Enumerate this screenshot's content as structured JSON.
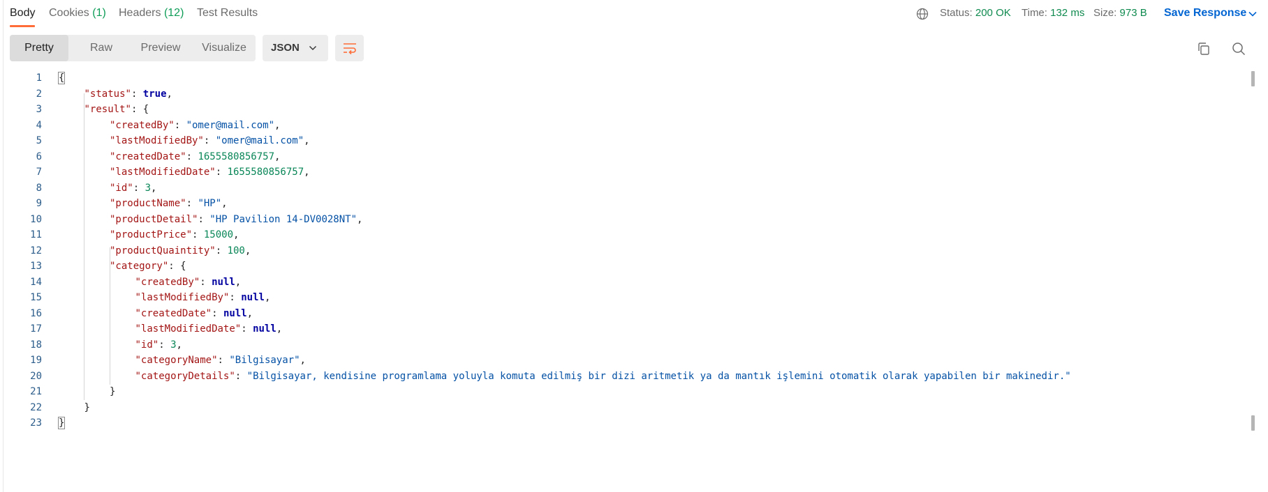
{
  "tabs": [
    {
      "label": "Body",
      "count": ""
    },
    {
      "label": "Cookies",
      "count": "(1)"
    },
    {
      "label": "Headers",
      "count": "(12)"
    },
    {
      "label": "Test Results",
      "count": ""
    }
  ],
  "status": {
    "status_label": "Status:",
    "status_value": "200 OK",
    "time_label": "Time:",
    "time_value": "132 ms",
    "size_label": "Size:",
    "size_value": "973 B"
  },
  "save_response_label": "Save Response",
  "view_tabs": [
    "Pretty",
    "Raw",
    "Preview",
    "Visualize"
  ],
  "format_select": "JSON",
  "colors": {
    "accent": "#ff6c37",
    "link": "#0265d2",
    "success": "#0f8a4f",
    "json_key": "#a31515",
    "json_string": "#0451a5",
    "json_number": "#098658",
    "json_literal": "#0000a0"
  },
  "icons": [
    "globe-icon",
    "chevron-down-icon",
    "wrap-lines-icon",
    "copy-icon",
    "search-icon"
  ],
  "code_lines": [
    {
      "n": "1",
      "indent": 0,
      "tokens": [
        {
          "t": "p",
          "v": "{"
        }
      ]
    },
    {
      "n": "2",
      "indent": 1,
      "tokens": [
        {
          "t": "k",
          "v": "\"status\""
        },
        {
          "t": "p",
          "v": ": "
        },
        {
          "t": "b",
          "v": "true"
        },
        {
          "t": "p",
          "v": ","
        }
      ]
    },
    {
      "n": "3",
      "indent": 1,
      "tokens": [
        {
          "t": "k",
          "v": "\"result\""
        },
        {
          "t": "p",
          "v": ": {"
        }
      ]
    },
    {
      "n": "4",
      "indent": 2,
      "tokens": [
        {
          "t": "k",
          "v": "\"createdBy\""
        },
        {
          "t": "p",
          "v": ": "
        },
        {
          "t": "s",
          "v": "\"omer@mail.com\""
        },
        {
          "t": "p",
          "v": ","
        }
      ]
    },
    {
      "n": "5",
      "indent": 2,
      "tokens": [
        {
          "t": "k",
          "v": "\"lastModifiedBy\""
        },
        {
          "t": "p",
          "v": ": "
        },
        {
          "t": "s",
          "v": "\"omer@mail.com\""
        },
        {
          "t": "p",
          "v": ","
        }
      ]
    },
    {
      "n": "6",
      "indent": 2,
      "tokens": [
        {
          "t": "k",
          "v": "\"createdDate\""
        },
        {
          "t": "p",
          "v": ": "
        },
        {
          "t": "n",
          "v": "1655580856757"
        },
        {
          "t": "p",
          "v": ","
        }
      ]
    },
    {
      "n": "7",
      "indent": 2,
      "tokens": [
        {
          "t": "k",
          "v": "\"lastModifiedDate\""
        },
        {
          "t": "p",
          "v": ": "
        },
        {
          "t": "n",
          "v": "1655580856757"
        },
        {
          "t": "p",
          "v": ","
        }
      ]
    },
    {
      "n": "8",
      "indent": 2,
      "tokens": [
        {
          "t": "k",
          "v": "\"id\""
        },
        {
          "t": "p",
          "v": ": "
        },
        {
          "t": "n",
          "v": "3"
        },
        {
          "t": "p",
          "v": ","
        }
      ]
    },
    {
      "n": "9",
      "indent": 2,
      "tokens": [
        {
          "t": "k",
          "v": "\"productName\""
        },
        {
          "t": "p",
          "v": ": "
        },
        {
          "t": "s",
          "v": "\"HP\""
        },
        {
          "t": "p",
          "v": ","
        }
      ]
    },
    {
      "n": "10",
      "indent": 2,
      "tokens": [
        {
          "t": "k",
          "v": "\"productDetail\""
        },
        {
          "t": "p",
          "v": ": "
        },
        {
          "t": "s",
          "v": "\"HP Pavilion 14-DV0028NT\""
        },
        {
          "t": "p",
          "v": ","
        }
      ]
    },
    {
      "n": "11",
      "indent": 2,
      "tokens": [
        {
          "t": "k",
          "v": "\"productPrice\""
        },
        {
          "t": "p",
          "v": ": "
        },
        {
          "t": "n",
          "v": "15000"
        },
        {
          "t": "p",
          "v": ","
        }
      ]
    },
    {
      "n": "12",
      "indent": 2,
      "tokens": [
        {
          "t": "k",
          "v": "\"productQuaintity\""
        },
        {
          "t": "p",
          "v": ": "
        },
        {
          "t": "n",
          "v": "100"
        },
        {
          "t": "p",
          "v": ","
        }
      ]
    },
    {
      "n": "13",
      "indent": 2,
      "tokens": [
        {
          "t": "k",
          "v": "\"category\""
        },
        {
          "t": "p",
          "v": ": {"
        }
      ]
    },
    {
      "n": "14",
      "indent": 3,
      "tokens": [
        {
          "t": "k",
          "v": "\"createdBy\""
        },
        {
          "t": "p",
          "v": ": "
        },
        {
          "t": "b",
          "v": "null"
        },
        {
          "t": "p",
          "v": ","
        }
      ]
    },
    {
      "n": "15",
      "indent": 3,
      "tokens": [
        {
          "t": "k",
          "v": "\"lastModifiedBy\""
        },
        {
          "t": "p",
          "v": ": "
        },
        {
          "t": "b",
          "v": "null"
        },
        {
          "t": "p",
          "v": ","
        }
      ]
    },
    {
      "n": "16",
      "indent": 3,
      "tokens": [
        {
          "t": "k",
          "v": "\"createdDate\""
        },
        {
          "t": "p",
          "v": ": "
        },
        {
          "t": "b",
          "v": "null"
        },
        {
          "t": "p",
          "v": ","
        }
      ]
    },
    {
      "n": "17",
      "indent": 3,
      "tokens": [
        {
          "t": "k",
          "v": "\"lastModifiedDate\""
        },
        {
          "t": "p",
          "v": ": "
        },
        {
          "t": "b",
          "v": "null"
        },
        {
          "t": "p",
          "v": ","
        }
      ]
    },
    {
      "n": "18",
      "indent": 3,
      "tokens": [
        {
          "t": "k",
          "v": "\"id\""
        },
        {
          "t": "p",
          "v": ": "
        },
        {
          "t": "n",
          "v": "3"
        },
        {
          "t": "p",
          "v": ","
        }
      ]
    },
    {
      "n": "19",
      "indent": 3,
      "tokens": [
        {
          "t": "k",
          "v": "\"categoryName\""
        },
        {
          "t": "p",
          "v": ": "
        },
        {
          "t": "s",
          "v": "\"Bilgisayar\""
        },
        {
          "t": "p",
          "v": ","
        }
      ]
    },
    {
      "n": "20",
      "indent": 3,
      "tokens": [
        {
          "t": "k",
          "v": "\"categoryDetails\""
        },
        {
          "t": "p",
          "v": ": "
        },
        {
          "t": "s",
          "v": "\"Bilgisayar, kendisine programlama yoluyla komuta edilmiş bir dizi aritmetik ya da mantık işlemini otomatik olarak yapabilen bir makinedir.\""
        }
      ]
    },
    {
      "n": "21",
      "indent": 2,
      "tokens": [
        {
          "t": "p",
          "v": "}"
        }
      ]
    },
    {
      "n": "22",
      "indent": 1,
      "tokens": [
        {
          "t": "p",
          "v": "}"
        }
      ]
    },
    {
      "n": "23",
      "indent": 0,
      "tokens": [
        {
          "t": "p",
          "v": "}"
        }
      ]
    }
  ]
}
